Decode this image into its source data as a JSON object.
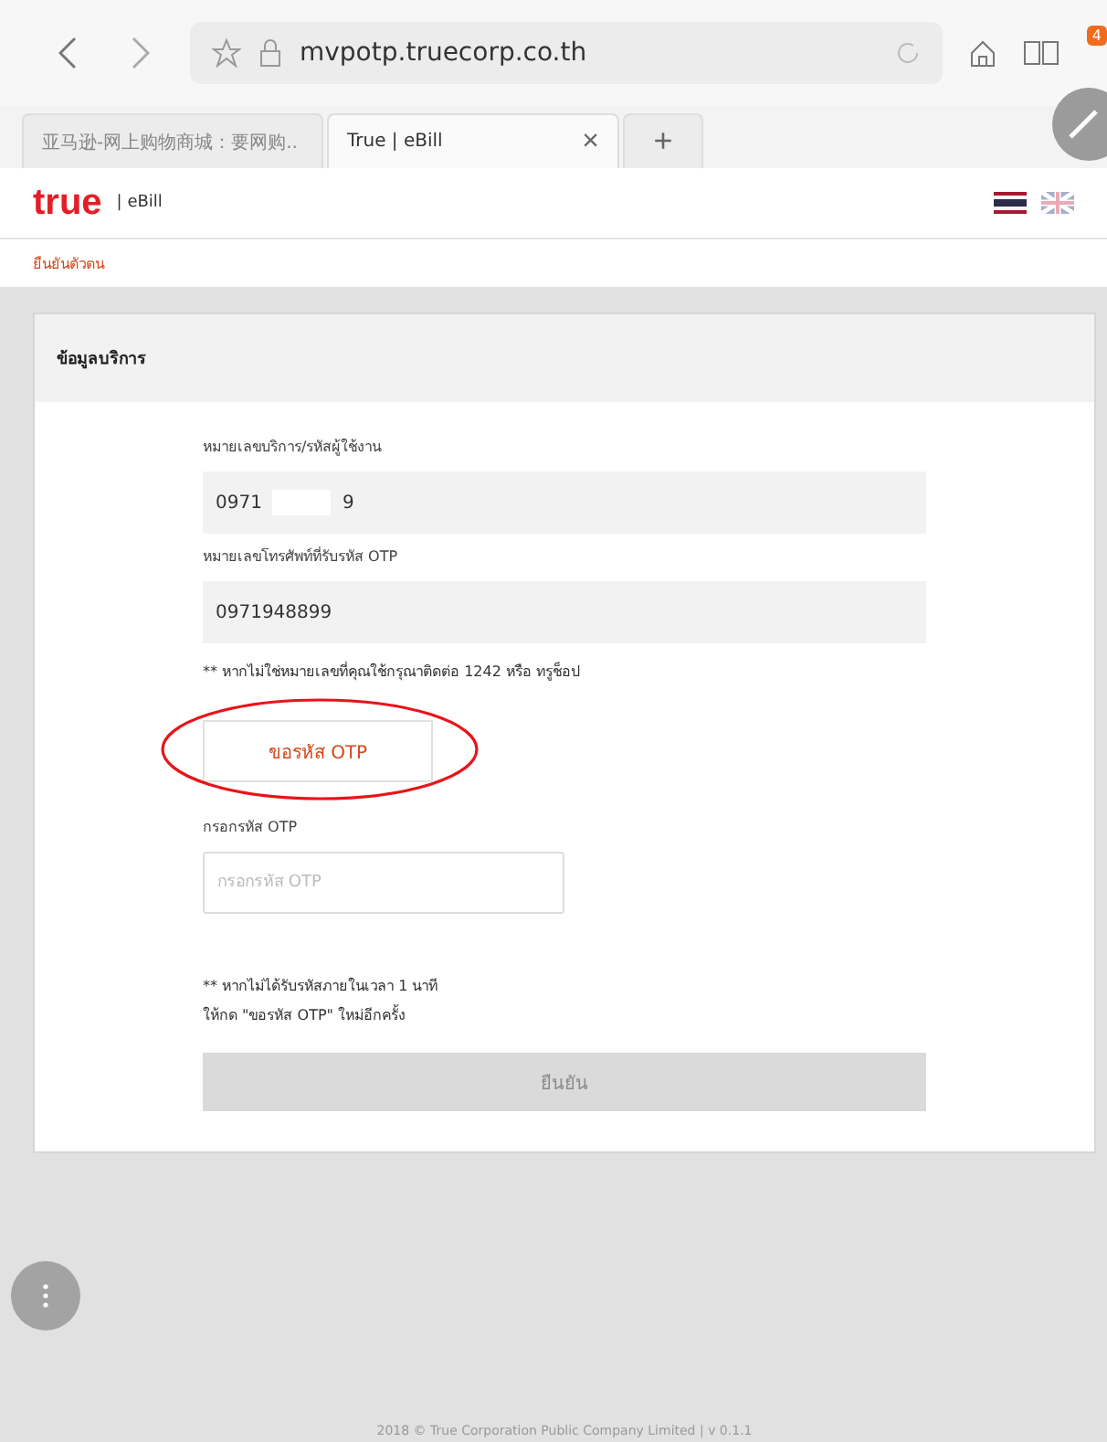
{
  "browser": {
    "url": "mvpotp.truecorp.co.th",
    "notification_count": "4",
    "tabs": [
      {
        "label": "亚马逊-网上购物商城：要网购..",
        "selected": false
      },
      {
        "label": "True | eBill",
        "selected": true
      }
    ],
    "new_tab": "+",
    "close": "×"
  },
  "site": {
    "logo": "true",
    "product": "| eBill",
    "languages": [
      {
        "kind": "th",
        "selected": true
      },
      {
        "kind": "en",
        "selected": false
      }
    ]
  },
  "breadcrumb": "ยืนยันตัวตน",
  "card": {
    "title": "ข้อมูลบริการ",
    "fields": [
      {
        "label": "หมายเลขบริการ/รหัสผู้ใช้งาน",
        "value_parts": [
          "0971",
          "9"
        ]
      },
      {
        "label": "หมายเลขโทรศัพท์ที่รับรหัส OTP",
        "value_parts": [
          "0971948899"
        ]
      }
    ],
    "note": "** หากไม่ใช่หมายเลขที่คุณใช้กรุณาติดต่อ 1242 หรือ ทรูช็อป",
    "request_button": "ขอรหัส OTP",
    "request_highlighted": true,
    "otp_label": "กรอกรหัส OTP",
    "otp_placeholder": "กรอกรหัส OTP",
    "hint_lines": [
      "** หากไม่ได้รับรหัสภายในเวลา 1 นาที",
      "ให้กด \"ขอรหัส OTP\" ใหม่อีกครั้ง"
    ],
    "confirm_button": "ยืนยัน",
    "confirm_disabled": true
  },
  "footer": "2018 © True Corporation Public Company Limited | v 0.1.1"
}
